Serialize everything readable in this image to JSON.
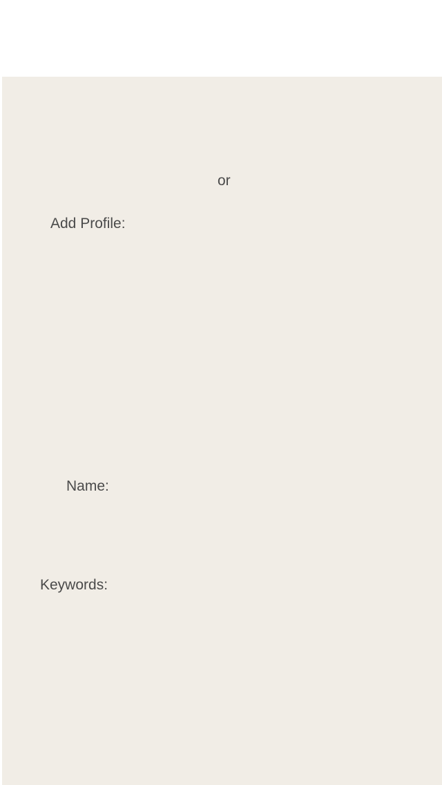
{
  "separator": {
    "text": "or"
  },
  "add_profile": {
    "label": "Add Profile:"
  },
  "form": {
    "name_label": "Name:",
    "keywords_label": "Keywords:"
  },
  "colors": {
    "panel_background": "#f1ede6",
    "label_text": "#4a4a4a",
    "top_background": "#ffffff"
  }
}
